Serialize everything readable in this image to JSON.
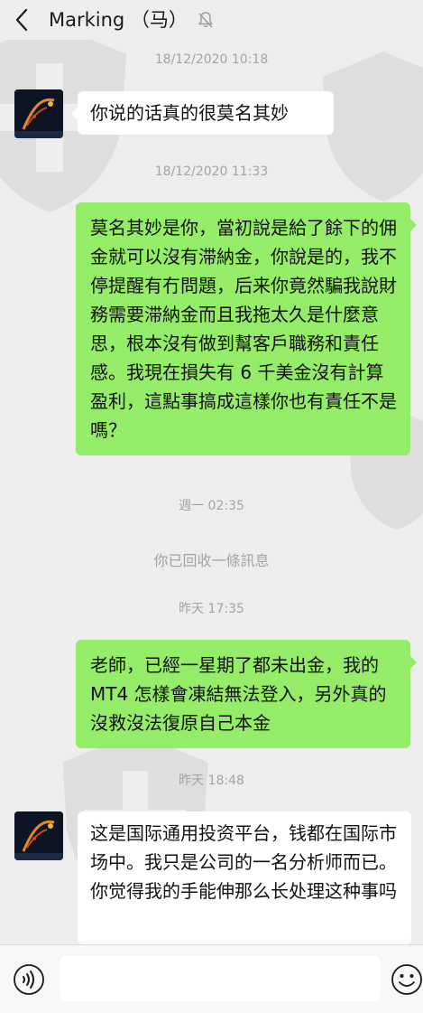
{
  "header": {
    "back_icon": "chevron-left-icon",
    "title": "Marking （马）",
    "mute_icon": "bell-slash-icon"
  },
  "messages": [
    {
      "type": "time",
      "text": "18/12/2020 10:18"
    },
    {
      "type": "incoming",
      "text": "你说的话真的很莫名其妙"
    },
    {
      "type": "time",
      "text": "18/12/2020 11:33"
    },
    {
      "type": "outgoing",
      "text": "莫名其妙是你，當初說是給了餘下的佣金就可以沒有滞納金，你說是的，我不停提醒有冇問題，后来你竟然騙我說財務需要滞納金而且我拖太久是什麼意思，根本沒有做到幫客戶職務和責任感。我現在損失有 6 千美金沒有計算盈利，這點事搞成這樣你也有責任不是嗎？"
    },
    {
      "type": "time",
      "text": "週一 02:35"
    },
    {
      "type": "notice",
      "text": "你已回收一條訊息"
    },
    {
      "type": "time",
      "text": "昨天 17:35"
    },
    {
      "type": "outgoing",
      "text": "老師，已經一星期了都未出金，我的 MT4 怎樣會凍結無法登入，另外真的沒救沒法復原自己本金"
    },
    {
      "type": "time",
      "text": "昨天 18:48"
    },
    {
      "type": "incoming",
      "text": "这是国际通用投资平台，钱都在国际市场中。我只是公司的一名分析师而已。你觉得我的手能伸那么长处理这种事吗"
    }
  ],
  "input_bar": {
    "voice_icon": "voice-icon",
    "input_value": "",
    "input_placeholder": "",
    "emoji_icon": "emoji-icon"
  },
  "colors": {
    "background": "#ededed",
    "outgoing_bubble": "#95ec69",
    "incoming_bubble": "#ffffff",
    "timestamp": "#a3a3a3"
  }
}
